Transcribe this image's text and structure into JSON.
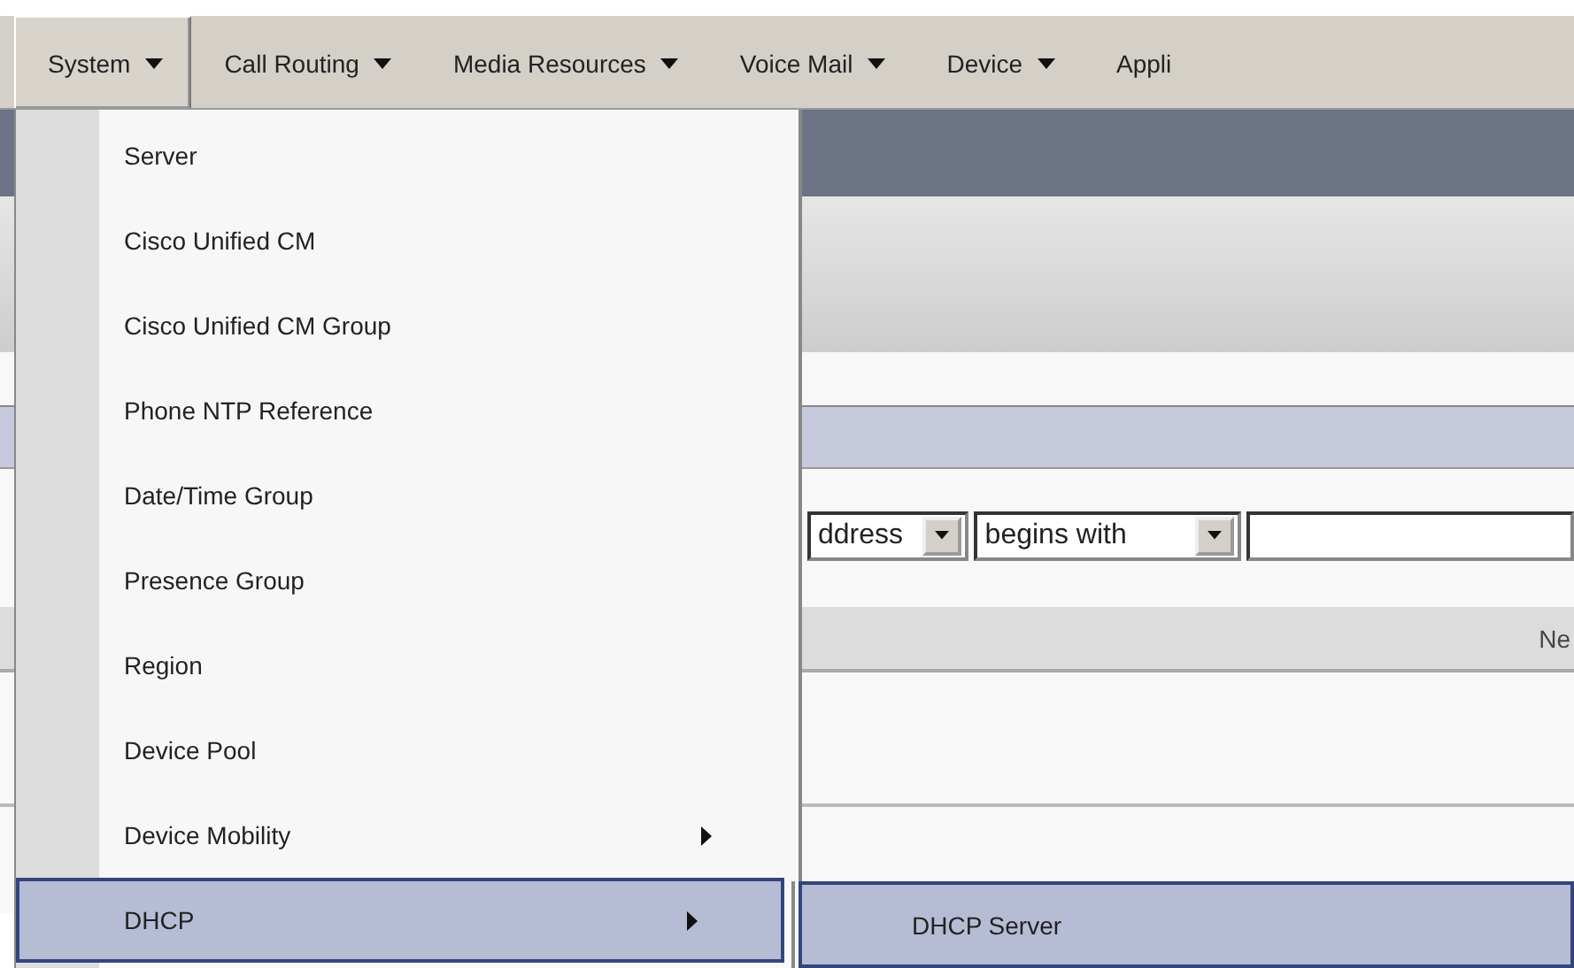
{
  "menubar": [
    {
      "label": "System",
      "selected": true
    },
    {
      "label": "Call Routing",
      "selected": false
    },
    {
      "label": "Media Resources",
      "selected": false
    },
    {
      "label": "Voice Mail",
      "selected": false
    },
    {
      "label": "Device",
      "selected": false
    },
    {
      "label": "Appli",
      "selected": false
    }
  ],
  "system_menu": [
    {
      "label": "Server",
      "has_submenu": false,
      "selected": false
    },
    {
      "label": "Cisco Unified CM",
      "has_submenu": false,
      "selected": false
    },
    {
      "label": "Cisco Unified CM Group",
      "has_submenu": false,
      "selected": false
    },
    {
      "label": "Phone NTP Reference",
      "has_submenu": false,
      "selected": false
    },
    {
      "label": "Date/Time Group",
      "has_submenu": false,
      "selected": false
    },
    {
      "label": "Presence Group",
      "has_submenu": false,
      "selected": false
    },
    {
      "label": "Region",
      "has_submenu": false,
      "selected": false
    },
    {
      "label": "Device Pool",
      "has_submenu": false,
      "selected": false
    },
    {
      "label": "Device Mobility",
      "has_submenu": true,
      "selected": false
    },
    {
      "label": "DHCP",
      "has_submenu": true,
      "selected": true
    }
  ],
  "dhcp_submenu": [
    {
      "label": "DHCP Server",
      "selected": true
    }
  ],
  "search": {
    "field_select": "ddress",
    "operator_select": "begins with"
  },
  "table": {
    "columns": [
      "Ne"
    ]
  }
}
